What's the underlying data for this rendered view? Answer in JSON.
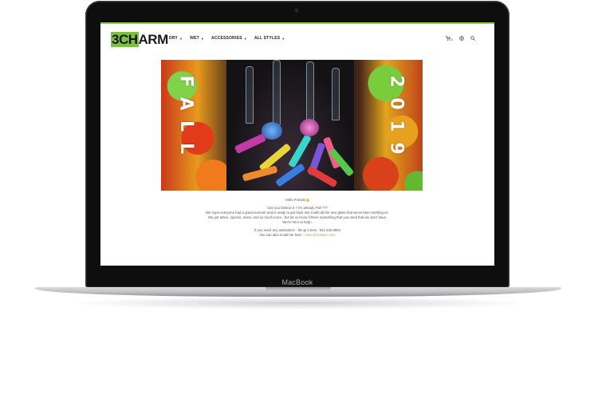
{
  "device": {
    "label": "MacBook"
  },
  "site": {
    "logo_text": "3CHARM",
    "nav": [
      {
        "label": "DRY"
      },
      {
        "label": "WET"
      },
      {
        "label": "ACCESSORIES"
      },
      {
        "label": "ALL STYLES"
      }
    ],
    "cart_count": "0",
    "banner": {
      "left_text": [
        "F",
        "A",
        "L",
        "L"
      ],
      "right_text": [
        "2",
        "0",
        "1",
        "9"
      ]
    },
    "message": {
      "greeting": "Hello Friends",
      "lines": [
        "Can you believe it ? it's already Fall ???",
        "We hope everyone had a great summer and is ready to get back into it with all the new glass that we've been working on.",
        "We got tubes, spoons, onies, and so much more - but let us know if there something that you need that we don't have.",
        "We're here to help !"
      ],
      "assist_line": "If you need any assistance - hit up Carrie : 541.225.9864",
      "email_prefix": "You can also email her here : ",
      "email": "carrie@3charm.com"
    }
  }
}
